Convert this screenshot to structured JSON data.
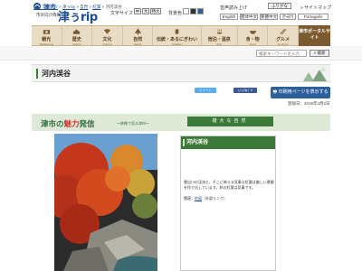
{
  "header": {
    "city": "津市",
    "subtitle": "市外向け情報",
    "brand": "津ぅrip",
    "text_size_label": "文字サイズ",
    "text_size_buttons": [
      "中",
      "大",
      "特大"
    ],
    "color_label": "背景色",
    "voice_label": "音声読み上げ",
    "furigana_label": "ふりがな",
    "sitemap_label": "» サイトマップ",
    "languages": [
      "English",
      "簡体中文",
      "繁體中文",
      "한국어",
      "Português"
    ]
  },
  "nav": {
    "items": [
      {
        "label": "観光",
        "en": "Sightseeing"
      },
      {
        "label": "歴史",
        "en": "History"
      },
      {
        "label": "文化",
        "en": "Culture"
      },
      {
        "label": "自然",
        "en": "Nature"
      },
      {
        "label": "伝統・あるにぎわい",
        "en": "Tradition"
      },
      {
        "label": "宿泊・温泉",
        "en": "Stay"
      },
      {
        "label": "食・物",
        "en": "Food"
      },
      {
        "label": "グルメ",
        "en": "Gourmet"
      }
    ],
    "portal_label": "津市ポータルサイト"
  },
  "breadcrumb": {
    "items": [
      "トップページ",
      "津ぅrip",
      "自然",
      "紅葉"
    ],
    "current": "河内渓谷"
  },
  "search": {
    "placeholder": "検索キーワードを入力",
    "button_label": "検索"
  },
  "page": {
    "title": "河内渓谷",
    "tweet_label": "ツイート",
    "like_label": "いいね！0",
    "print_label": "印刷用ページを表示する",
    "date": "登録日：2019年4月2日"
  },
  "feature": {
    "heading_prefix": "津市の",
    "heading_accent": "魅力",
    "heading_suffix": "発信",
    "subheading": "〜映像で見る津市〜",
    "section_label": "雄大な自然",
    "item_title": "河内渓谷",
    "description": "雲出川の渓流と、そこに映える見事な紅葉は美しい景観を作り出しています。秋の紅葉は見事です。",
    "link_prefix": "関連：",
    "link_text": "地図",
    "link_suffix": "（外部リンク）"
  },
  "colors": {
    "brand_blue": "#1d4f8f",
    "nav_bg": "#e8dcc4",
    "green": "#3c7a3a",
    "print_blue": "#2d5f9c"
  }
}
